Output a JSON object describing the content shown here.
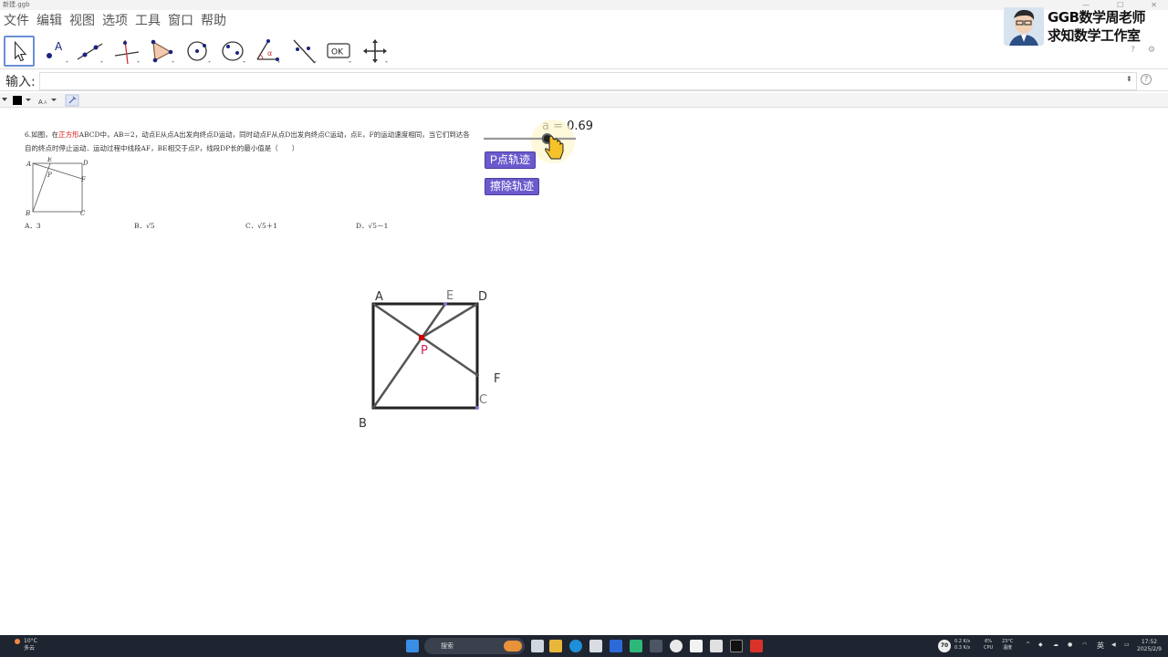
{
  "window": {
    "title": "新建.ggb"
  },
  "menu": [
    "文件",
    "编辑",
    "视图",
    "选项",
    "工具",
    "窗口",
    "帮助"
  ],
  "brand": {
    "line1": "GGB数学周老师",
    "line2": "求知数学工作室"
  },
  "toolbar_tools": [
    "move-tool-icon",
    "point-tool-icon",
    "line-tool-icon",
    "perpendicular-tool-icon",
    "polygon-tool-icon",
    "circle-tool-icon",
    "circle-three-points-tool-icon",
    "angle-tool-icon",
    "reflect-tool-icon",
    "ok-tool-icon",
    "move-view-tool-icon"
  ],
  "ok_label": "OK",
  "input_bar": {
    "label": "输入:",
    "value": ""
  },
  "problem": {
    "number": "6",
    "text_a": ".如图，在",
    "highlight": "正方形",
    "text_b": "ABCD中，AB＝2，动点E从点A出发向终点D运动，同时动点F从点D出发向终点C运动，点E，F的运动速度相同，当它们到达各自的终点时停止运动．运动过程中线段AF，BE相交于点P，线段DP长的最小值是（　　）",
    "figure_labels": {
      "A": "A",
      "E": "E",
      "D": "D",
      "P": "P",
      "F": "F",
      "B": "B",
      "C": "C"
    },
    "options": [
      "A．3",
      "B．√5",
      "C．√5＋1",
      "D．√5－1"
    ]
  },
  "slider": {
    "label": "a = 0.69",
    "value": 0.69
  },
  "buttons": {
    "trace": "P点轨迹",
    "clear": "擦除轨迹"
  },
  "construction": {
    "labels": {
      "A": "A",
      "E": "E",
      "D": "D",
      "P": "P",
      "F": "F",
      "B": "B",
      "C": "C"
    },
    "point_color": "#cc0000"
  },
  "taskbar": {
    "weather_temp": "10°C",
    "weather_desc": "多云",
    "search_placeholder": "搜索",
    "net_up": "0.2 K/s",
    "net_down": "0.3 K/s",
    "cpu": "6%",
    "cpu_label": "CPU",
    "temp": "23°C",
    "temp_label": "温度",
    "ime": "英",
    "time": "17:52",
    "date": "2025/2/9",
    "badge": "70"
  },
  "colors": {
    "button_bg": "#6a5acd",
    "highlight": "#dd1111",
    "point_P": "#cc0000"
  }
}
